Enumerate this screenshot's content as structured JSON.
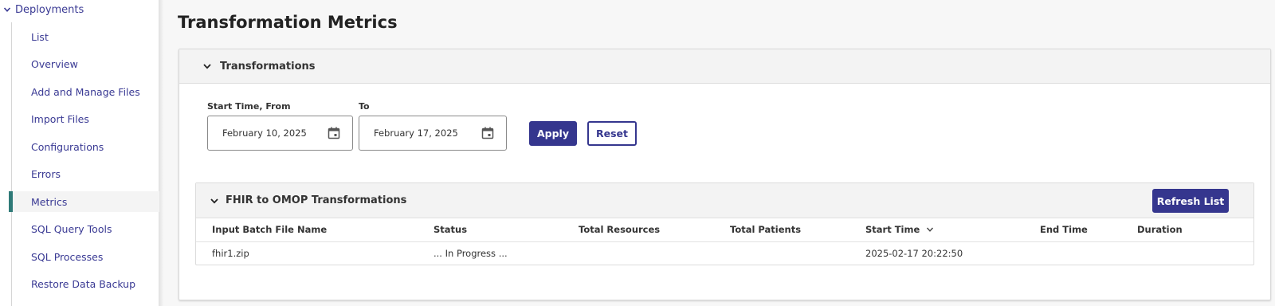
{
  "sidebar": {
    "group_label": "Deployments",
    "items": [
      {
        "label": "List"
      },
      {
        "label": "Overview"
      },
      {
        "label": "Add and Manage Files"
      },
      {
        "label": "Import Files"
      },
      {
        "label": "Configurations"
      },
      {
        "label": "Errors"
      },
      {
        "label": "Metrics"
      },
      {
        "label": "SQL Query Tools"
      },
      {
        "label": "SQL Processes"
      },
      {
        "label": "Restore Data Backup"
      }
    ],
    "active_item": "Metrics"
  },
  "page": {
    "title": "Transformation Metrics"
  },
  "transformations_panel": {
    "title": "Transformations",
    "from_label": "Start Time, From",
    "from_value": "February 10, 2025",
    "to_label": "To",
    "to_value": "February 17, 2025",
    "apply_label": "Apply",
    "reset_label": "Reset"
  },
  "fhir_panel": {
    "title": "FHIR to OMOP Transformations",
    "refresh_label": "Refresh List",
    "columns": [
      "Input Batch File Name",
      "Status",
      "Total Resources",
      "Total Patients",
      "Start Time",
      "End Time",
      "Duration"
    ],
    "sorted_column": "Start Time",
    "rows": [
      {
        "file": "fhir1.zip",
        "status": "... In Progress ...",
        "total_resources": "",
        "total_patients": "",
        "start_time": "2025-02-17 20:22:50",
        "end_time": "",
        "duration": ""
      }
    ]
  },
  "colors": {
    "accent": "#35368e",
    "link": "#3a3a94",
    "active_marker": "#2f7a78"
  },
  "icons": {
    "collapse": "chevron-down-icon",
    "calendar": "calendar-icon",
    "sort": "sort-desc-icon"
  }
}
